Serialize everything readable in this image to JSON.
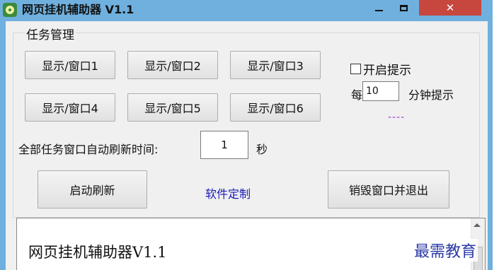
{
  "window": {
    "title": "网页挂机辅助器 V1.1",
    "controls": {
      "minimize": "–",
      "maximize": "□",
      "close": "✕"
    },
    "icon": "app-icon"
  },
  "task_group": {
    "label": "任务管理",
    "window_buttons": [
      "显示/窗口1",
      "显示/窗口2",
      "显示/窗口3",
      "显示/窗口4",
      "显示/窗口5",
      "显示/窗口6"
    ]
  },
  "reminder": {
    "checkbox_label": "开启提示",
    "checked": false,
    "every_label": "每:",
    "minutes_value": "10",
    "minutes_suffix": "分钟提示",
    "status": "----"
  },
  "refresh": {
    "label": "全部任务窗口自动刷新时间:",
    "value": "1",
    "unit": "秒"
  },
  "actions": {
    "start_refresh": "启动刷新",
    "custom_link": "软件定制",
    "destroy_exit": "销毁窗口并退出"
  },
  "textarea": {
    "text": "网页挂机辅助器V1.1"
  },
  "watermark": "最需教育",
  "colors": {
    "titlebar": "#6fb0de",
    "close_button": "#c7473e",
    "link": "#1a1ab5",
    "status": "#9b3cd3"
  }
}
